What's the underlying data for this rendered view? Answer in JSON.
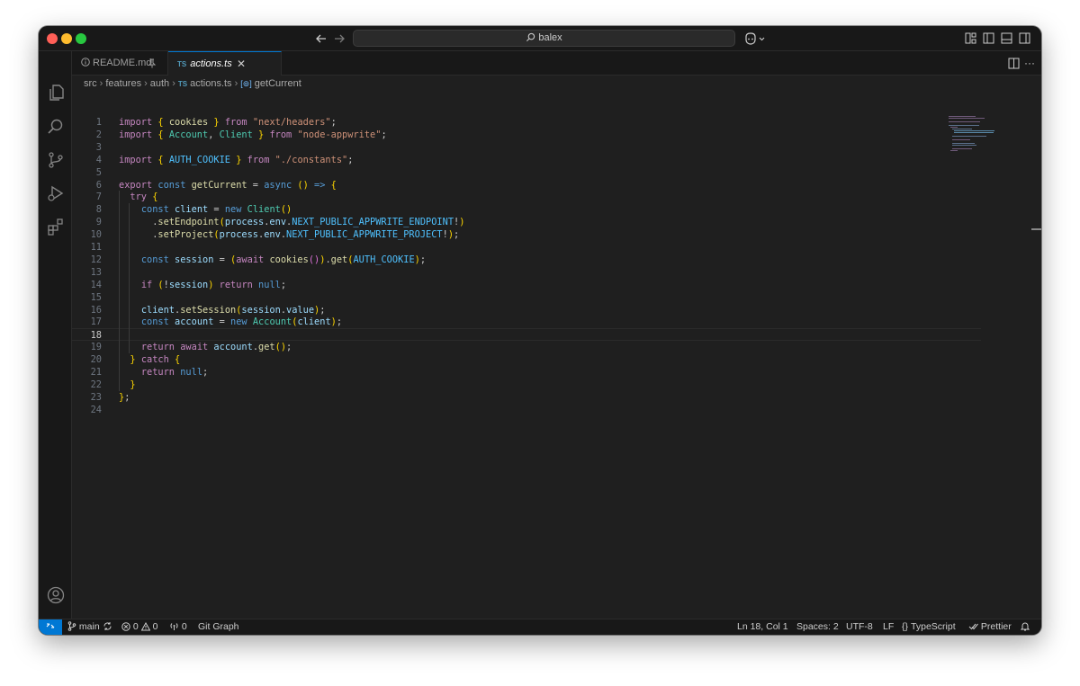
{
  "titlebar": {
    "search_text": "balex"
  },
  "tabs": [
    {
      "label": "README.md",
      "active": false
    },
    {
      "label": "actions.ts",
      "active": true,
      "lang_badge": "TS"
    }
  ],
  "breadcrumb": {
    "items": [
      "src",
      "features",
      "auth",
      "actions.ts",
      "getCurrent"
    ],
    "lang_badge": "TS"
  },
  "editor": {
    "current_line": 18,
    "line_numbers": [
      "1",
      "2",
      "3",
      "4",
      "5",
      "6",
      "7",
      "8",
      "9",
      "10",
      "11",
      "12",
      "13",
      "14",
      "15",
      "16",
      "17",
      "18",
      "19",
      "20",
      "21",
      "22",
      "23",
      "24"
    ],
    "lines": [
      "import { cookies } from \"next/headers\";",
      "import { Account, Client } from \"node-appwrite\";",
      "",
      "import { AUTH_COOKIE } from \"./constants\";",
      "",
      "export const getCurrent = async () => {",
      "  try {",
      "    const client = new Client()",
      "      .setEndpoint(process.env.NEXT_PUBLIC_APPWRITE_ENDPOINT!)",
      "      .setProject(process.env.NEXT_PUBLIC_APPWRITE_PROJECT!);",
      "",
      "    const session = (await cookies()).get(AUTH_COOKIE);",
      "",
      "    if (!session) return null;",
      "",
      "    client.setSession(session.value);",
      "    const account = new Account(client);",
      "",
      "    return await account.get();",
      "  } catch {",
      "    return null;",
      "  }",
      "};",
      ""
    ]
  },
  "statusbar": {
    "branch": "main",
    "errors": "0",
    "warnings": "0",
    "ports": "0",
    "git_graph": "Git Graph",
    "cursor": "Ln 18, Col 1",
    "spaces": "Spaces: 2",
    "encoding": "UTF-8",
    "eol": "LF",
    "language": "TypeScript",
    "formatter": "Prettier"
  },
  "colors": {
    "accent": "#0078d4",
    "keyword": "#c586c0",
    "storage": "#569cd6",
    "variable": "#9cdcfe",
    "constant": "#4fc1ff",
    "function": "#dcdcaa",
    "string": "#ce9178",
    "class": "#4ec9b0"
  }
}
